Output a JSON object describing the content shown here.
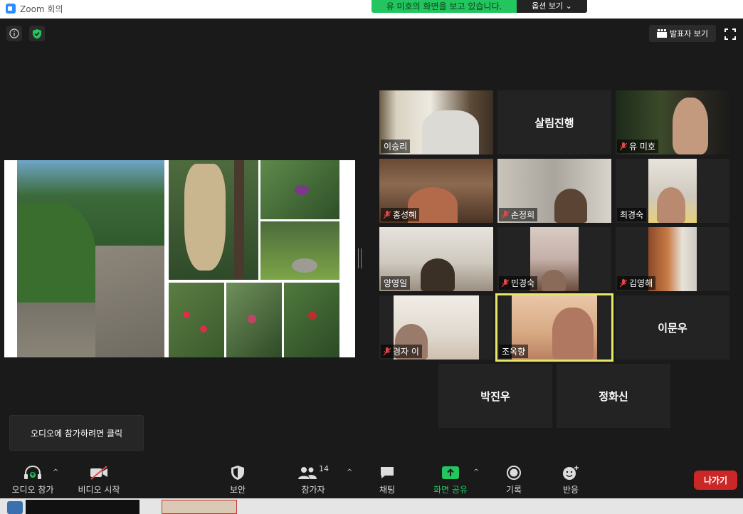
{
  "window": {
    "title": "Zoom 회의"
  },
  "banner": {
    "viewing_text": "유 미호의 화면을 보고 있습니다.",
    "view_options_label": "옵션 보기"
  },
  "top_controls": {
    "speaker_view_label": "발표자 보기"
  },
  "participants": [
    {
      "name": "이승리",
      "muted": false,
      "video": true,
      "active": false
    },
    {
      "name": "살림진행",
      "muted": false,
      "video": false,
      "active": false
    },
    {
      "name": "유 미호",
      "muted": true,
      "video": true,
      "active": false
    },
    {
      "name": "홍성혜",
      "muted": true,
      "video": true,
      "active": false
    },
    {
      "name": "손정희",
      "muted": true,
      "video": true,
      "active": false
    },
    {
      "name": "최경숙",
      "muted": false,
      "video": true,
      "active": false
    },
    {
      "name": "양영일",
      "muted": false,
      "video": true,
      "active": false
    },
    {
      "name": "민경숙",
      "muted": true,
      "video": true,
      "active": false
    },
    {
      "name": "김영해",
      "muted": true,
      "video": true,
      "active": false
    },
    {
      "name": "경자 이",
      "muted": true,
      "video": true,
      "active": false
    },
    {
      "name": "조옥향",
      "muted": false,
      "video": true,
      "active": true
    },
    {
      "name": "이문우",
      "muted": false,
      "video": false,
      "active": false
    },
    {
      "name": "박진우",
      "muted": false,
      "video": false,
      "active": false
    },
    {
      "name": "정화신",
      "muted": false,
      "video": false,
      "active": false
    }
  ],
  "tooltip": {
    "text": "오디오에 참가하려면 클릭"
  },
  "toolbar": {
    "audio_label": "오디오 참가",
    "video_label": "비디오 시작",
    "security_label": "보안",
    "participants_label": "참가자",
    "participants_count": "14",
    "chat_label": "채팅",
    "share_label": "화면 공유",
    "record_label": "기록",
    "reactions_label": "반응",
    "leave_label": "나가기"
  },
  "colors": {
    "share_green": "#22c55e",
    "leave_red": "#cc2727",
    "active_speaker": "#e7e76a",
    "app_blue": "#2d8cff"
  }
}
